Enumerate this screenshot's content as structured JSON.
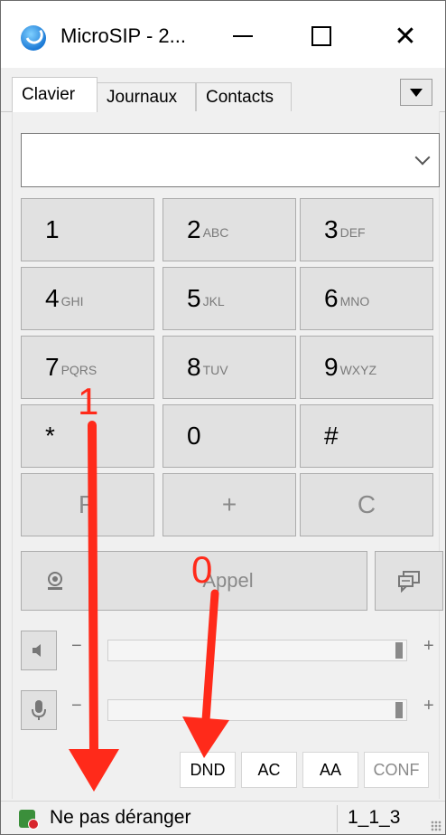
{
  "window": {
    "title": "MicroSIP - 2..."
  },
  "tabs": [
    {
      "label": "Clavier",
      "active": true
    },
    {
      "label": "Journaux",
      "active": false
    },
    {
      "label": "Contacts",
      "active": false
    }
  ],
  "dial_input": {
    "value": "",
    "placeholder": ""
  },
  "keypad": [
    {
      "digit": "1",
      "letters": ""
    },
    {
      "digit": "2",
      "letters": "ABC"
    },
    {
      "digit": "3",
      "letters": "DEF"
    },
    {
      "digit": "4",
      "letters": "GHI"
    },
    {
      "digit": "5",
      "letters": "JKL"
    },
    {
      "digit": "6",
      "letters": "MNO"
    },
    {
      "digit": "7",
      "letters": "PQRS"
    },
    {
      "digit": "8",
      "letters": "TUV"
    },
    {
      "digit": "9",
      "letters": "WXYZ"
    },
    {
      "digit": "*",
      "letters": ""
    },
    {
      "digit": "0",
      "letters": ""
    },
    {
      "digit": "#",
      "letters": ""
    },
    {
      "digit": "R",
      "letters": ""
    },
    {
      "digit": "+",
      "letters": ""
    },
    {
      "digit": "C",
      "letters": ""
    }
  ],
  "call": {
    "label": "Appel"
  },
  "volume": {
    "minus": "−",
    "plus": "+",
    "speaker_level": 1.0,
    "mic_level": 1.0
  },
  "modes": [
    {
      "label": "DND",
      "enabled": true
    },
    {
      "label": "AC",
      "enabled": true
    },
    {
      "label": "AA",
      "enabled": true
    },
    {
      "label": "CONF",
      "enabled": false
    }
  ],
  "status": {
    "text": "Ne pas déranger",
    "account": "1_1_3"
  },
  "annotations": {
    "label_1": "1",
    "label_0": "0",
    "color": "#ff2a1a"
  }
}
